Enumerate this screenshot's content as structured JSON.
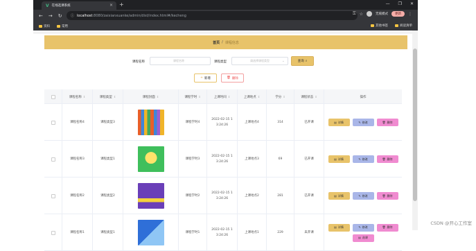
{
  "browser": {
    "tab_title": "在线选课系统",
    "new_tab_symbol": "+",
    "url_host": "localhost",
    "url_port_path": ":8080/zaixianxuanke/admin/dist/index.html#/kecheng",
    "profile_label": "无痕模式",
    "update_label": "更新",
    "bookmarks": [
      "资料",
      "常用"
    ],
    "bookmarks_right": [
      "其他书签",
      "阅读清单"
    ]
  },
  "breadcrumb": {
    "home": "首页",
    "sep": "/",
    "current": "课程信息"
  },
  "search": {
    "name_label": "课程名称",
    "name_placeholder": "课程名称",
    "type_label": "课程类型",
    "type_placeholder": "请选择课程类型",
    "query_label": "查询"
  },
  "actions": {
    "add_label": "新增",
    "delete_label": "删除"
  },
  "table": {
    "headers": [
      "课程名称",
      "课程类型",
      "课程封面",
      "课程学时",
      "上课时间",
      "上课地点",
      "学分",
      "课程状态",
      "操作"
    ],
    "rows": [
      {
        "name": "课程名称4",
        "type": "课程类型3",
        "hours": "课程学时4",
        "time1": "2022-02-15 1",
        "time2": "3:24:26",
        "place": "上课地点4",
        "credit": "314",
        "status": "已开课",
        "thumb": "books"
      },
      {
        "name": "课程名称3",
        "type": "课程类型1",
        "hours": "课程学时3",
        "time1": "2022-02-15 1",
        "time2": "3:24:26",
        "place": "上课地点3",
        "credit": "69",
        "status": "已开课",
        "thumb": "green"
      },
      {
        "name": "课程名称2",
        "type": "课程类型2",
        "hours": "课程学时2",
        "time1": "2022-02-15 1",
        "time2": "3:24:26",
        "place": "上课地点2",
        "credit": "281",
        "status": "已开课",
        "thumb": "purple"
      },
      {
        "name": "课程名称1",
        "type": "课程类型1",
        "hours": "课程学时1",
        "time1": "2022-02-15 1",
        "time2": "3:24:26",
        "place": "上课地点1",
        "credit": "229",
        "status": "未开课",
        "thumb": "blue"
      }
    ],
    "op_detail": "详情",
    "op_edit": "修改",
    "op_delete": "删除",
    "op_select": "选课"
  },
  "watermark": "CSDN @开心工作室",
  "colors": {
    "accent": "#e8c36a",
    "edit": "#a9b6e8",
    "delete": "#f08bd0"
  }
}
